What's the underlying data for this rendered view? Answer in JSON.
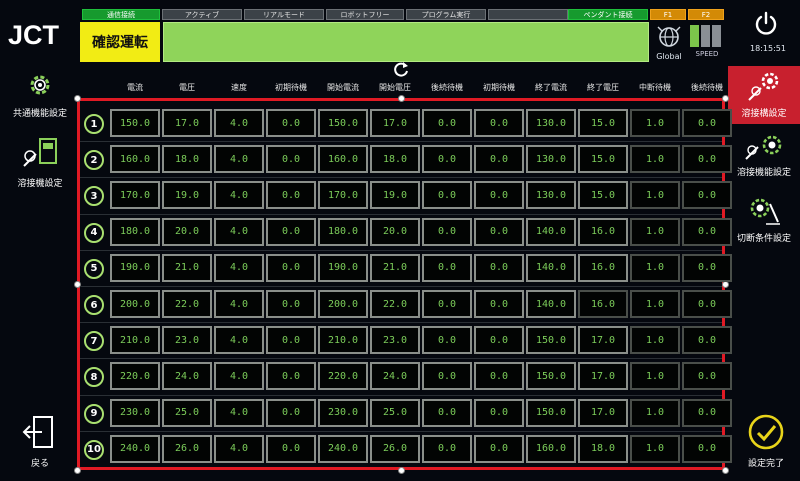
{
  "brand": {
    "logo_text": "JCT"
  },
  "status_bar": [
    {
      "label": "通信接続",
      "state": "on"
    },
    {
      "label": "アクティブ",
      "state": "off"
    },
    {
      "label": "リアルモード",
      "state": "off"
    },
    {
      "label": "ロボットフリー",
      "state": "off"
    },
    {
      "label": "プログラム実行",
      "state": "off"
    },
    {
      "label": "",
      "state": "off"
    },
    {
      "label": "ペンダント接続",
      "state": "on"
    },
    {
      "label": "F1",
      "state": "amber"
    },
    {
      "label": "F2",
      "state": "amber"
    }
  ],
  "header": {
    "mode": "確認運転",
    "global_label": "Global",
    "speed_label": "SPEED",
    "time": "18:15:51"
  },
  "left_nav": {
    "common_settings": "共通機能設定",
    "welder_settings": "溶接機設定",
    "back": "戻る"
  },
  "right_nav": {
    "welding_conditions": "溶接構設定",
    "welding_function": "溶接機能設定",
    "cut_conditions": "切断条件設定",
    "complete": "設定完了"
  },
  "columns": [
    "電流",
    "電圧",
    "速度",
    "初期待機",
    "開始電流",
    "開始電圧",
    "後続待機",
    "初期待機",
    "終了電流",
    "終了電圧",
    "中断待機",
    "後続待機"
  ],
  "rows": [
    {
      "no": "1",
      "values": [
        "150.0",
        "17.0",
        "4.0",
        "0.0",
        "150.0",
        "17.0",
        "0.0",
        "0.0",
        "130.0",
        "15.0",
        "1.0",
        "0.0"
      ]
    },
    {
      "no": "2",
      "values": [
        "160.0",
        "18.0",
        "4.0",
        "0.0",
        "160.0",
        "18.0",
        "0.0",
        "0.0",
        "130.0",
        "15.0",
        "1.0",
        "0.0"
      ]
    },
    {
      "no": "3",
      "values": [
        "170.0",
        "19.0",
        "4.0",
        "0.0",
        "170.0",
        "19.0",
        "0.0",
        "0.0",
        "130.0",
        "15.0",
        "1.0",
        "0.0"
      ]
    },
    {
      "no": "4",
      "values": [
        "180.0",
        "20.0",
        "4.0",
        "0.0",
        "180.0",
        "20.0",
        "0.0",
        "0.0",
        "140.0",
        "16.0",
        "1.0",
        "0.0"
      ]
    },
    {
      "no": "5",
      "values": [
        "190.0",
        "21.0",
        "4.0",
        "0.0",
        "190.0",
        "21.0",
        "0.0",
        "0.0",
        "140.0",
        "16.0",
        "1.0",
        "0.0"
      ]
    },
    {
      "no": "6",
      "values": [
        "200.0",
        "22.0",
        "4.0",
        "0.0",
        "200.0",
        "22.0",
        "0.0",
        "0.0",
        "140.0",
        "16.0",
        "1.0",
        "0.0"
      ]
    },
    {
      "no": "7",
      "values": [
        "210.0",
        "23.0",
        "4.0",
        "0.0",
        "210.0",
        "23.0",
        "0.0",
        "0.0",
        "150.0",
        "17.0",
        "1.0",
        "0.0"
      ]
    },
    {
      "no": "8",
      "values": [
        "220.0",
        "24.0",
        "4.0",
        "0.0",
        "220.0",
        "24.0",
        "0.0",
        "0.0",
        "150.0",
        "17.0",
        "1.0",
        "0.0"
      ]
    },
    {
      "no": "9",
      "values": [
        "230.0",
        "25.0",
        "4.0",
        "0.0",
        "230.0",
        "25.0",
        "0.0",
        "0.0",
        "150.0",
        "17.0",
        "1.0",
        "0.0"
      ]
    },
    {
      "no": "10",
      "values": [
        "240.0",
        "26.0",
        "4.0",
        "0.0",
        "240.0",
        "26.0",
        "0.0",
        "0.0",
        "160.0",
        "18.0",
        "1.0",
        "0.0"
      ]
    }
  ],
  "colors": {
    "accent_red": "#e01a24",
    "value_green": "#7ccd5a",
    "mode_yellow": "#f2ec14",
    "status_green": "#169a2e"
  }
}
